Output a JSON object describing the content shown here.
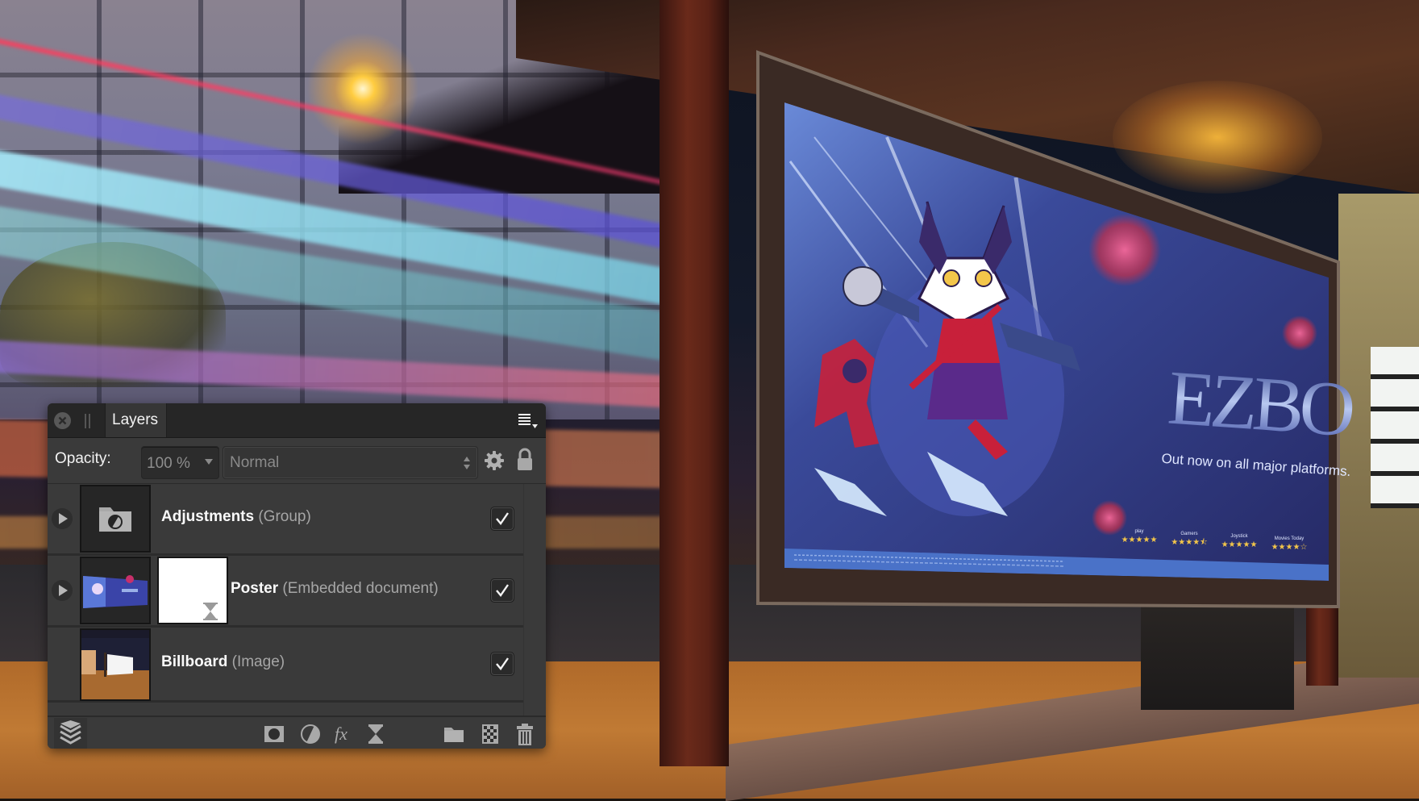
{
  "scene": {
    "poster": {
      "title": "EZBO",
      "tagline": "Out now on all major platforms.",
      "ratings": [
        {
          "source": "play",
          "stars": 5
        },
        {
          "source": "Gamers",
          "stars": 4.5
        },
        {
          "source": "Joystick",
          "stars": 5
        },
        {
          "source": "Movies Today",
          "stars": 4
        }
      ],
      "colors": {
        "background": "#2b2f6e",
        "accent_red": "#d9304a",
        "gold": "#f3c64a",
        "footer": "#4a72c8"
      }
    }
  },
  "panel": {
    "tab_label": "Layers",
    "icons": {
      "close": "close-icon",
      "grip": "grip-icon",
      "menu": "panel-menu-icon"
    },
    "opacity_label": "Opacity:",
    "opacity_value": "100 %",
    "blend_mode": "Normal",
    "layers": [
      {
        "name": "Adjustments",
        "type": "(Group)",
        "visible": true,
        "expandable": true,
        "thumbnail": "folder-adjustment-icon"
      },
      {
        "name": "Poster",
        "type": "(Embedded document)",
        "visible": true,
        "expandable": true,
        "thumbnail": "poster-thumbnail"
      },
      {
        "name": "Billboard",
        "type": "(Image)",
        "visible": true,
        "expandable": false,
        "thumbnail": "billboard-thumbnail"
      }
    ],
    "bottom_tools": [
      {
        "name": "mask-layer",
        "icon": "mask-icon"
      },
      {
        "name": "adjustment",
        "icon": "adjustment-icon"
      },
      {
        "name": "live-filter",
        "icon": "fx-icon"
      },
      {
        "name": "live-filter-layer",
        "icon": "hourglass-icon"
      },
      {
        "name": "add-group",
        "icon": "folder-icon"
      },
      {
        "name": "add-pixel-layer",
        "icon": "checkerboard-icon"
      },
      {
        "name": "delete-layer",
        "icon": "trash-icon"
      }
    ],
    "colors": {
      "panel_bg": "#3a3a3a",
      "header_bg": "#262626",
      "text": "#f2f2f2",
      "muted_text": "#a6a6a6"
    }
  }
}
